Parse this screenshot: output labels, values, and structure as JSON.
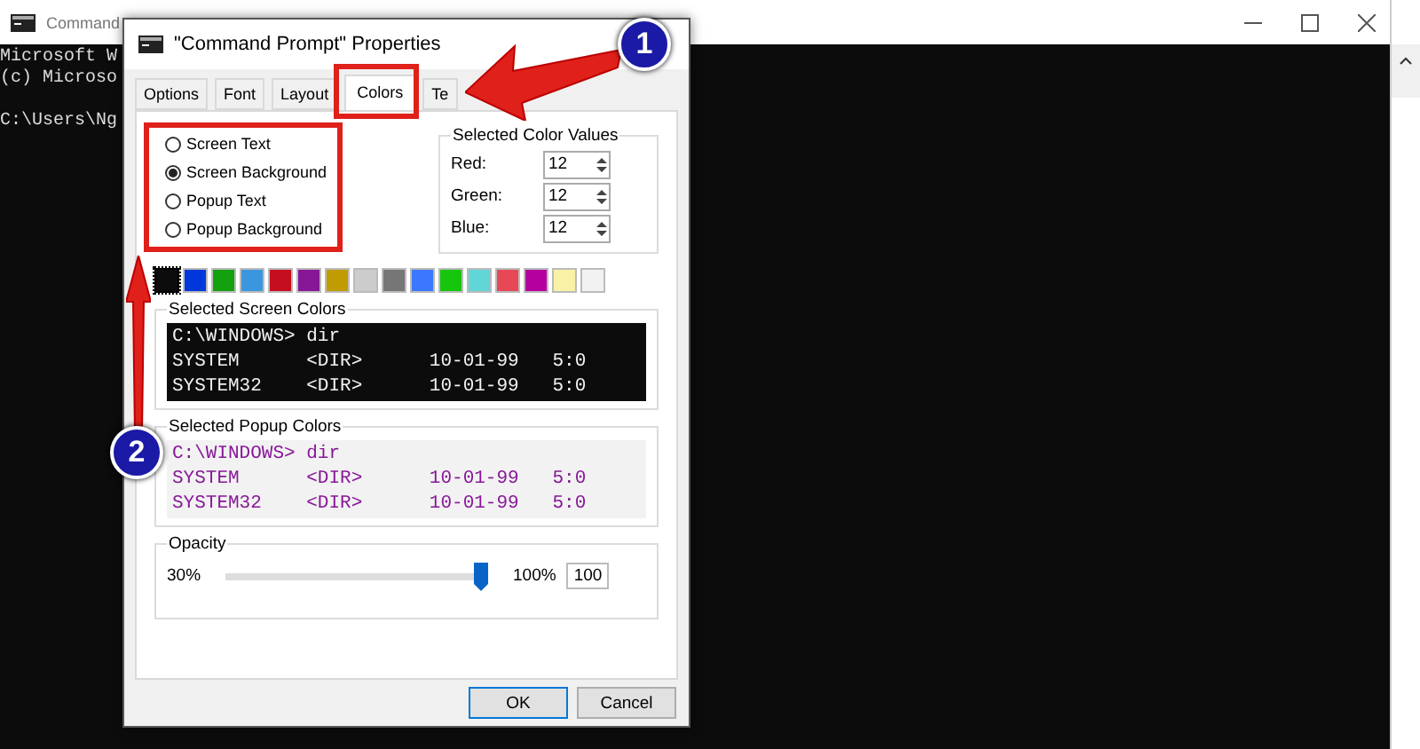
{
  "console": {
    "title": "Command",
    "lines": [
      "Microsoft W",
      "(c) Microso",
      "C:\\Users\\Ng"
    ]
  },
  "dialog": {
    "title": "\"Command Prompt\" Properties",
    "tabs": [
      {
        "label": "Options",
        "selected": false
      },
      {
        "label": "Font",
        "selected": false
      },
      {
        "label": "Layout",
        "selected": false
      },
      {
        "label": "Colors",
        "selected": true
      },
      {
        "label": "Te",
        "selected": false
      }
    ],
    "radios": [
      {
        "label": "Screen Text",
        "selected": false
      },
      {
        "label": "Screen Background",
        "selected": true
      },
      {
        "label": "Popup Text",
        "selected": false
      },
      {
        "label": "Popup Background",
        "selected": false
      }
    ],
    "color_values": {
      "title": "Selected Color Values",
      "fields": [
        {
          "label": "Red:",
          "value": "12"
        },
        {
          "label": "Green:",
          "value": "12"
        },
        {
          "label": "Blue:",
          "value": "12"
        }
      ]
    },
    "palette": [
      {
        "color": "#0c0c0c",
        "selected": true
      },
      {
        "color": "#0037da",
        "selected": false
      },
      {
        "color": "#13a10e",
        "selected": false
      },
      {
        "color": "#3a96dd",
        "selected": false
      },
      {
        "color": "#c50f1f",
        "selected": false
      },
      {
        "color": "#881798",
        "selected": false
      },
      {
        "color": "#c19c00",
        "selected": false
      },
      {
        "color": "#cccccc",
        "selected": false
      },
      {
        "color": "#767676",
        "selected": false
      },
      {
        "color": "#3b78ff",
        "selected": false
      },
      {
        "color": "#16c60c",
        "selected": false
      },
      {
        "color": "#61d6d6",
        "selected": false
      },
      {
        "color": "#e74856",
        "selected": false
      },
      {
        "color": "#b4009e",
        "selected": false
      },
      {
        "color": "#f9f1a5",
        "selected": false
      },
      {
        "color": "#f2f2f2",
        "selected": false
      }
    ],
    "screen_preview": {
      "title": "Selected Screen Colors",
      "lines": [
        "C:\\WINDOWS> dir",
        "SYSTEM      <DIR>      10-01-99   5:0",
        "SYSTEM32    <DIR>      10-01-99   5:0"
      ]
    },
    "popup_preview": {
      "title": "Selected Popup Colors",
      "lines": [
        "C:\\WINDOWS> dir",
        "SYSTEM      <DIR>      10-01-99   5:0",
        "SYSTEM32    <DIR>      10-01-99   5:0"
      ]
    },
    "opacity": {
      "title": "Opacity",
      "min_label": "30%",
      "max_label": "100%",
      "level": 1,
      "value": "100"
    },
    "buttons": [
      "OK",
      "Cancel"
    ]
  },
  "annotations": [
    {
      "label": "1"
    },
    {
      "label": "2"
    }
  ]
}
